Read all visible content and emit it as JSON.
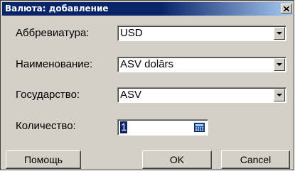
{
  "window": {
    "title": "Валюта: добавление",
    "close_icon": "close-icon"
  },
  "form": {
    "abbreviation": {
      "label": "Аббревиатура:",
      "value": "USD"
    },
    "name": {
      "label": "Наименование:",
      "value": "ASV dolārs"
    },
    "country": {
      "label": "Государство:",
      "value": "ASV"
    },
    "quantity": {
      "label": "Количество:",
      "value": "1",
      "button_icon": "calculator-icon"
    }
  },
  "buttons": {
    "help": "Помощь",
    "ok": "OK",
    "cancel": "Cancel"
  },
  "colors": {
    "title_active": "#0a246a",
    "title_gradient_end": "#a6caf0",
    "dialog_face": "#d4d0c8",
    "selection": "#0a246a"
  }
}
